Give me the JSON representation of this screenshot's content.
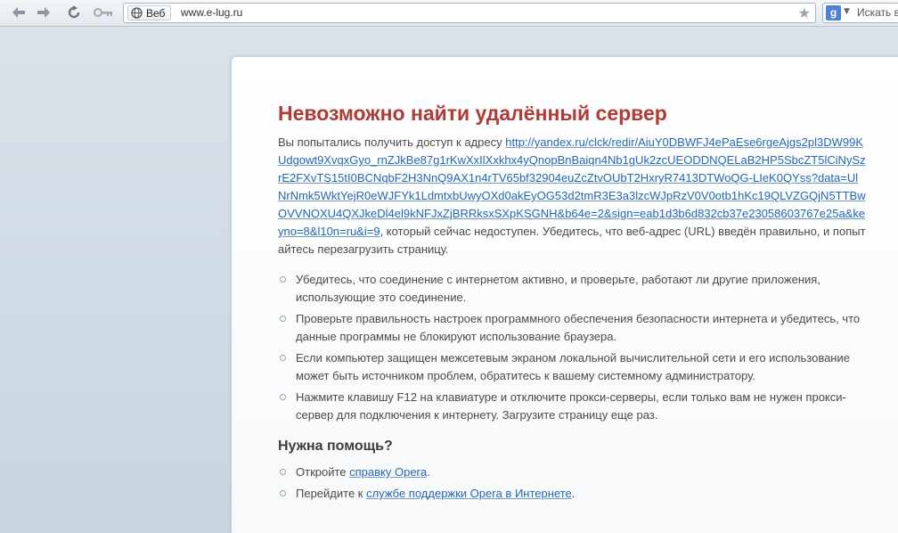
{
  "browser": {
    "address": "www.e-lug.ru",
    "web_badge": "Веб",
    "search_placeholder": "Искать в",
    "search_engine_letter": "g"
  },
  "error_page": {
    "title": "Невозможно найти удалённый сервер",
    "intro_before": "Вы попытались получить доступ к адресу ",
    "url": "http://yandex.ru/clck/redir/AiuY0DBWFJ4ePaEse6rgeAjgs2pl3DW99KUdgowt9XvqxGyo_rnZJkBe87g1rKwXxIlXxkhx4yQnopBnBaiqn4Nb1gUk2zcUEODDNQELaB2HP5SbcZT5lCiNySzrE2FXvTS15tI0BCNqbF2H3NnQ9AX1n4rTV65bf32904euZcZtvOUbT2HxryR7413DTWoQG-LIeK0QYss?data=UlNrNmk5WktYejR0eWJFYk1LdmtxbUwyOXd0akEyOG53d2tmR3E3a3lzcWJpRzV0V0otb1hKc19QLVZGQjN5TTBwOVVNOXU4QXJkeDl4el9kNFJxZjBRRksxSXpKSGNH&b64e=2&sign=eab1d3b6d832cb37e23058603767e25a&keyno=8&l10n=ru&i=9",
    "intro_after": ", который сейчас недоступен. Убедитесь, что веб-адрес (URL) введён правильно, и попытайтесь перезагрузить страницу.",
    "tips": [
      "Убедитесь, что соединение с интернетом активно, и проверьте, работают ли другие приложения, использующие это соединение.",
      "Проверьте правильность настроек программного обеспечения безопасности интернета и убедитесь, что данные программы не блокируют использование браузера.",
      "Если компьютер защищен межсетевым экраном локальной вычислительной сети и его использование может быть источником проблем, обратитесь к вашему системному администратору.",
      "Нажмите клавишу F12 на клавиатуре и отключите прокси-серверы, если только вам не нужен прокси-сервер для подключения к интернету. Загрузите страницу еще раз."
    ],
    "help_heading": "Нужна помощь?",
    "help_items": [
      {
        "before": "Откройте ",
        "link": "справку Opera",
        "after": "."
      },
      {
        "before": "Перейдите к ",
        "link": "службе поддержки Opera в Интернете",
        "after": "."
      }
    ]
  },
  "colors": {
    "title": "#b03a35",
    "link": "#2567b3",
    "body_text": "#4a4a4a"
  },
  "icons": [
    "back-arrow-icon",
    "forward-arrow-icon",
    "reload-icon",
    "key-icon",
    "globe-icon",
    "star-icon",
    "google-icon",
    "chevron-down-icon",
    "bullet-icon"
  ]
}
